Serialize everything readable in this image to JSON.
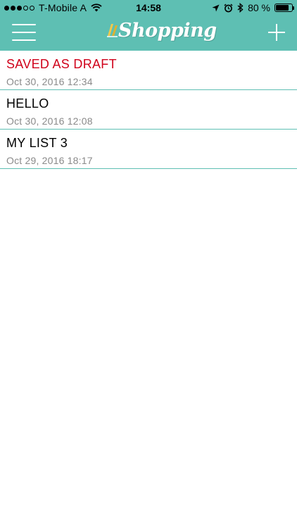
{
  "status_bar": {
    "carrier": "T-Mobile A",
    "time": "14:58",
    "battery_percent": "80 %",
    "battery_level": 0.8,
    "signal_strength": 3,
    "signal_max": 5
  },
  "nav": {
    "logo_text": "Shopping"
  },
  "lists": [
    {
      "title": "SAVED AS DRAFT",
      "date": "Oct 30, 2016 12:34",
      "draft": true
    },
    {
      "title": "HELLO",
      "date": "Oct 30, 2016 12:08",
      "draft": false
    },
    {
      "title": "MY LIST 3",
      "date": "Oct 29, 2016 18:17",
      "draft": false
    }
  ],
  "colors": {
    "accent": "#5ebfb3",
    "draft": "#d0021b",
    "date": "#8a8a8a"
  },
  "icons": {
    "menu": "hamburger-icon",
    "add": "plus-icon",
    "location": "location-arrow-icon",
    "alarm": "alarm-clock-icon",
    "bluetooth": "bluetooth-icon",
    "wifi": "wifi-icon",
    "battery": "battery-icon"
  }
}
